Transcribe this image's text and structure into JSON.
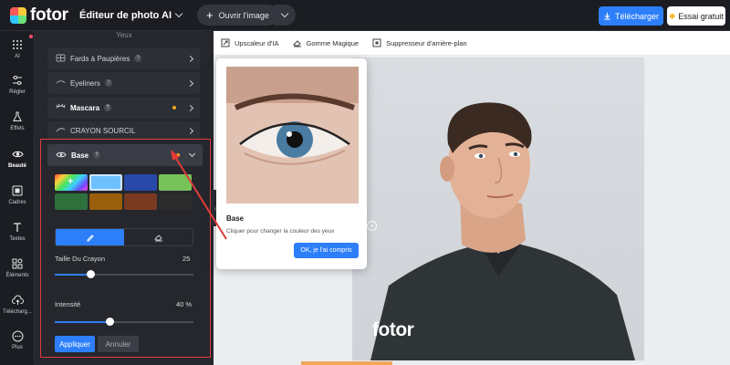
{
  "header": {
    "logo_text": "fotor",
    "editor_title": "Éditeur de photo AI",
    "open_image": "Ouvrir l'image",
    "download": "Télécharger",
    "trial": "Essai gratuit"
  },
  "rail": {
    "items": [
      {
        "label": "AI",
        "icon": "grid-icon"
      },
      {
        "label": "Régler",
        "icon": "sliders-icon"
      },
      {
        "label": "Effets",
        "icon": "flask-icon"
      },
      {
        "label": "Beauté",
        "icon": "eye-icon"
      },
      {
        "label": "Cadres",
        "icon": "frame-icon"
      },
      {
        "label": "Textes",
        "icon": "text-icon"
      },
      {
        "label": "Éléments",
        "icon": "elements-icon"
      },
      {
        "label": "Télécharg...",
        "icon": "upload-icon"
      },
      {
        "label": "Plus",
        "icon": "more-icon"
      }
    ],
    "active": "Beauté"
  },
  "panel": {
    "section": "Yeux",
    "tools": [
      {
        "label": "Fards à Paupières"
      },
      {
        "label": "Eyeliners"
      },
      {
        "label": "Mascara"
      },
      {
        "label": "CRAYON SOURCIL"
      }
    ],
    "base_label": "Base",
    "tabs": [
      "brush-icon",
      "eraser-icon"
    ],
    "brush_size_label": "Taille Du Crayon",
    "brush_size_value": "25",
    "brush_size_fraction": 0.26,
    "intensity_label": "Intensité",
    "intensity_value": "40 %",
    "intensity_fraction": 0.4,
    "apply": "Appliquer",
    "cancel": "Annuler"
  },
  "colors": {
    "swatches": [
      "#7f7fff",
      "#6ec1ff",
      "#2849a8",
      "#77c35a",
      "#2f6f3b",
      "#9a5f0a",
      "#7a3a22",
      "#2c2c2c"
    ]
  },
  "toolbar2": {
    "items": [
      {
        "label": "Upscaleur d'IA",
        "icon": "upscale-icon"
      },
      {
        "label": "Gomme Magique",
        "icon": "eraser-icon"
      },
      {
        "label": "Suppresseur d'arrière-plan",
        "icon": "bg-remove-icon"
      }
    ]
  },
  "tooltip": {
    "title": "Base",
    "desc": "Cliquer pour changer la couleur des yeux",
    "ok": "OK, je l'ai compris"
  },
  "canvas": {
    "watermark": "fotor"
  }
}
